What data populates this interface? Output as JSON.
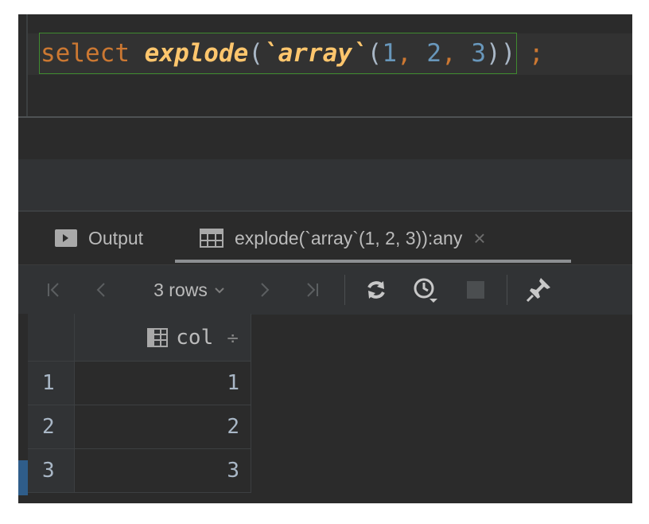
{
  "editor": {
    "tokens": {
      "keyword": "select",
      "space": " ",
      "function": "explode",
      "lparen": "(",
      "func2": "`array`",
      "lparen2": "(",
      "n1": "1",
      "comma1": ", ",
      "n2": "2",
      "comma2": ", ",
      "n3": "3",
      "rparens": "))",
      "semicolon": ";"
    }
  },
  "tabs": {
    "output_label": "Output",
    "result_label": "explode(`array`(1, 2, 3)):any",
    "close_glyph": "×"
  },
  "toolbar": {
    "first_glyph": "|<",
    "prev_glyph": "<",
    "rows_label": "3 rows",
    "rows_caret": "⌄",
    "next_glyph": ">",
    "last_glyph": ">|"
  },
  "table": {
    "column": "col",
    "sort_glyph": "÷",
    "rows": [
      {
        "num": "1",
        "value": "1"
      },
      {
        "num": "2",
        "value": "2"
      },
      {
        "num": "3",
        "value": "3"
      }
    ]
  },
  "colors": {
    "keyword": "#cc7832",
    "function": "#ffc66d",
    "number": "#6897bb",
    "text": "#a9b7c6",
    "background": "#2b2b2b"
  },
  "icons": [
    "output-icon",
    "table-grid-icon",
    "close-icon",
    "first-page-icon",
    "prev-page-icon",
    "next-page-icon",
    "last-page-icon",
    "refresh-icon",
    "history-icon",
    "stop-icon",
    "pin-icon",
    "column-icon"
  ]
}
